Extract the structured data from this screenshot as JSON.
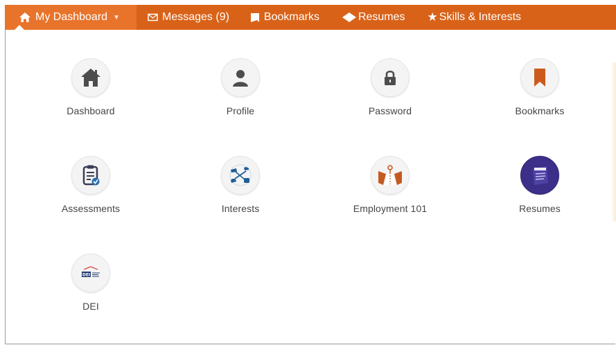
{
  "nav": {
    "items": [
      {
        "label": "My Dashboard",
        "icon": "home-icon",
        "active": true
      },
      {
        "label": "Messages (9)",
        "icon": "envelope-icon"
      },
      {
        "label": "Bookmarks",
        "icon": "bookmark-icon"
      },
      {
        "label": "Resumes",
        "icon": "diamond-icon"
      },
      {
        "label": "Skills & Interests",
        "icon": "star-icon"
      }
    ],
    "color": "#d96219"
  },
  "tiles": [
    {
      "label": "Dashboard",
      "icon": "home-icon"
    },
    {
      "label": "Profile",
      "icon": "user-icon"
    },
    {
      "label": "Password",
      "icon": "lock-icon"
    },
    {
      "label": "Bookmarks",
      "icon": "bookmark-icon"
    },
    {
      "label": "Assessments",
      "icon": "clipboard-check-icon"
    },
    {
      "label": "Interests",
      "icon": "interests-icon"
    },
    {
      "label": "Employment 101",
      "icon": "road-icon"
    },
    {
      "label": "Resumes",
      "icon": "resume-icon"
    },
    {
      "label": "DEI",
      "icon": "dei-logo-icon",
      "logo_text": "DEI"
    }
  ]
}
